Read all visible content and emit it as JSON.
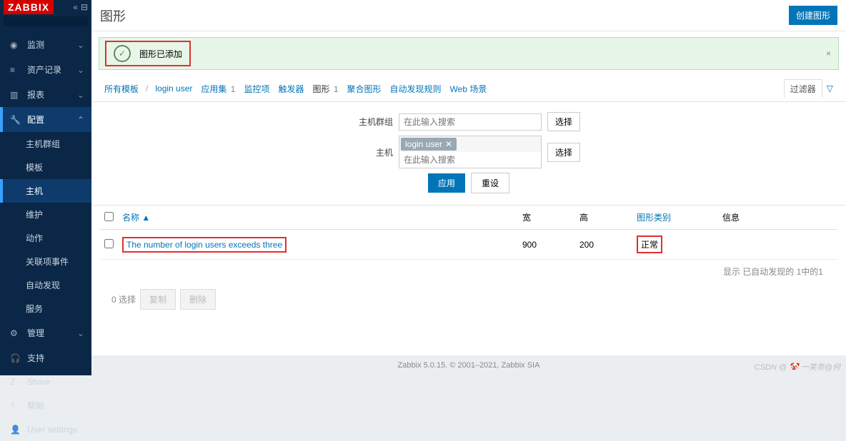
{
  "brand": "ZABBIX",
  "search": {
    "placeholder": ""
  },
  "nav": {
    "monitoring": "监测",
    "inventory": "资产记录",
    "reports": "报表",
    "config": "配置",
    "admin": "管理",
    "support": "支持",
    "share": "Share",
    "help": "帮助",
    "usersettings": "User settings"
  },
  "config_sub": {
    "hostgroups": "主机群组",
    "templates": "模板",
    "hosts": "主机",
    "maintenance": "维护",
    "actions": "动作",
    "correlation": "关联项事件",
    "discovery": "自动发现",
    "services": "服务"
  },
  "page": {
    "title": "图形",
    "create_btn": "创建图形"
  },
  "alert": {
    "text": "图形已添加"
  },
  "breadcrumb": {
    "all_templates": "所有模板",
    "host": "login user"
  },
  "tabs": {
    "applications": {
      "label": "应用集",
      "cnt": "1"
    },
    "items": {
      "label": "监控项"
    },
    "triggers": {
      "label": "触发器"
    },
    "graphs": {
      "label": "图形",
      "cnt": "1"
    },
    "screens": {
      "label": "聚合图形"
    },
    "drules": {
      "label": "自动发现规则"
    },
    "web": {
      "label": "Web 场景"
    },
    "filter_label": "过滤器"
  },
  "filter": {
    "hostgroup_label": "主机群组",
    "host_label": "主机",
    "search_ph": "在此输入搜索",
    "host_tag": "login user",
    "select_btn": "选择",
    "apply": "应用",
    "reset": "重设"
  },
  "table": {
    "headers": {
      "name": "名称",
      "sort": "▲",
      "width": "宽",
      "height": "高",
      "type": "图形类别",
      "info": "信息"
    },
    "rows": [
      {
        "name": "The number of login users exceeds three",
        "width": "900",
        "height": "200",
        "type": "正常"
      }
    ],
    "result": "显示 已自动发现的 1中的1"
  },
  "actionbar": {
    "sel": "0 选择",
    "copy": "复制",
    "del": "删除"
  },
  "footer": "Zabbix 5.0.15. © 2001–2021, Zabbix SIA",
  "watermark": "CSDN @ 🤡 一笑奈@何"
}
